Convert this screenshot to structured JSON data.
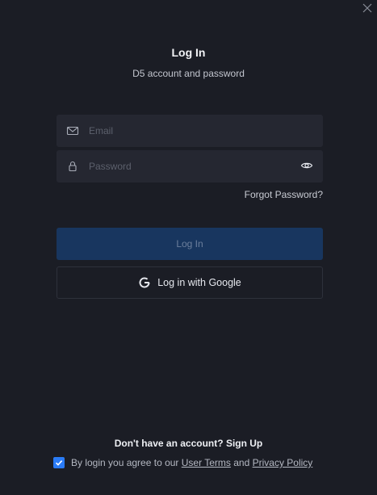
{
  "dialog": {
    "title": "Log In",
    "subtitle": "D5 account and password",
    "close_icon": "close-icon"
  },
  "form": {
    "email": {
      "placeholder": "Email",
      "value": "",
      "icon": "mail-icon"
    },
    "password": {
      "placeholder": "Password",
      "value": "",
      "icon": "lock-icon",
      "toggle_icon": "eye-icon"
    },
    "forgot_label": "Forgot Password?",
    "login_label": "Log In",
    "google_label": "Log in with Google",
    "google_icon": "google-icon"
  },
  "footer": {
    "no_account": "Don't have an account?",
    "sign_up": "Sign Up",
    "agree_prefix": "By login you agree to our",
    "user_terms": "User Terms",
    "and": "and",
    "privacy_policy": "Privacy Policy",
    "agree_checked": true
  },
  "colors": {
    "background": "#1b1d25",
    "field_bg": "#252731",
    "primary_button": "#18365f",
    "checkbox_accent": "#2a7bf6"
  }
}
